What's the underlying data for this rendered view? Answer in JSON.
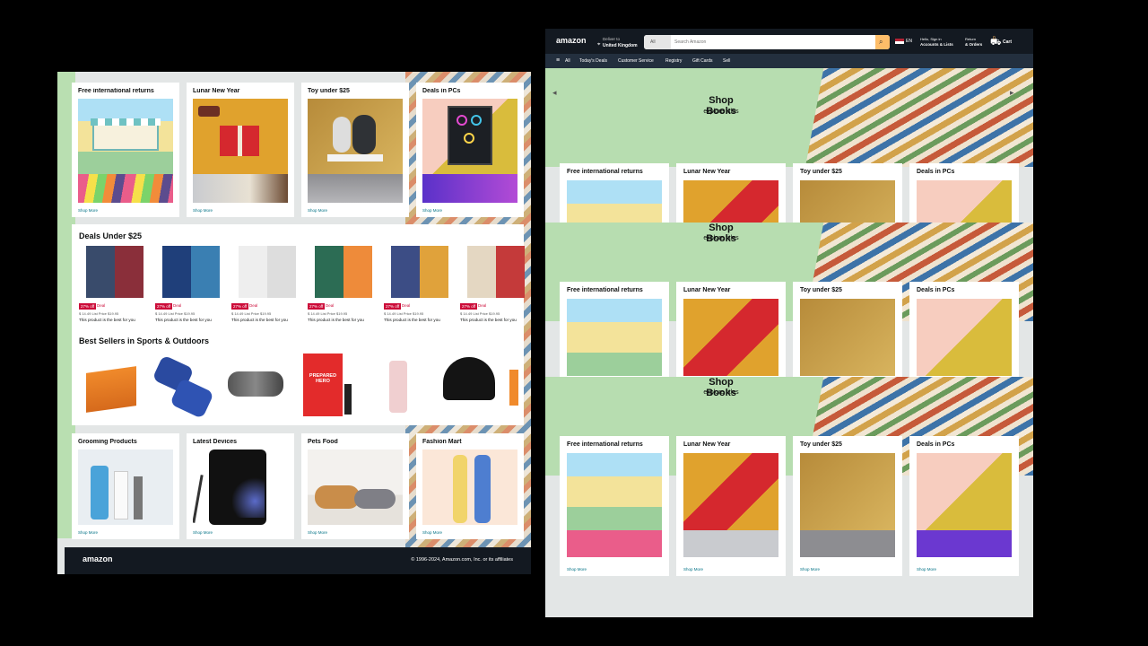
{
  "left": {
    "top_cards": [
      {
        "title": "Free international returns",
        "link": "Shop More"
      },
      {
        "title": "Lunar New Year",
        "link": "Shop More"
      },
      {
        "title": "Toy under $25",
        "link": "Shop More"
      },
      {
        "title": "Deals in PCs",
        "link": "Shop More"
      }
    ],
    "deals": {
      "title": "Deals Under $25",
      "items": [
        {
          "badge": "27% off",
          "label": "Deal",
          "price": "$ 14.49 List Price $19.95",
          "desc": "This product is the best for you"
        },
        {
          "badge": "27% off",
          "label": "Deal",
          "price": "$ 14.49 List Price $19.95",
          "desc": "This product is the best for you"
        },
        {
          "badge": "27% off",
          "label": "Deal",
          "price": "$ 14.49 List Price $19.95",
          "desc": "This product is the best for you"
        },
        {
          "badge": "27% off",
          "label": "Deal",
          "price": "$ 14.49 List Price $19.95",
          "desc": "This product is the best for you"
        },
        {
          "badge": "27% off",
          "label": "Deal",
          "price": "$ 14.49 List Price $19.95",
          "desc": "This product is the best for you"
        },
        {
          "badge": "27% off",
          "label": "Deal",
          "price": "$ 14.49 List Price $19.95",
          "desc": "This product is the best for you"
        }
      ]
    },
    "best_sellers": {
      "title": "Best Sellers in Sports & Outdoors",
      "hero_text": "PREPARED HERO"
    },
    "bottom_cards": [
      {
        "title": "Grooming Products",
        "link": "Shop More"
      },
      {
        "title": "Latest Devices",
        "link": "Shop More"
      },
      {
        "title": "Pets Food",
        "link": "Shop More"
      },
      {
        "title": "Fashion Mart",
        "link": "Shop More"
      }
    ],
    "footer": {
      "logo": "amazon",
      "copyright": "© 1996-2024, Amazon.com, Inc. or its affiliates"
    }
  },
  "right": {
    "header": {
      "logo": "amazon",
      "deliver_to": "Deliver to",
      "location": "United Kingdom",
      "search_category": "All",
      "search_placeholder": "Search Amazon",
      "language": "EN",
      "hello": "Hello, Sign in",
      "accounts": "Accounts & Lists",
      "returns": "Return",
      "orders": "& Orders",
      "cart_count": "0",
      "cart": "Cart"
    },
    "nav": [
      "All",
      "Today's Deals",
      "Customer Service",
      "Registry",
      "Gift Cards",
      "Sell"
    ],
    "banner": {
      "title": "Shop Books",
      "subtitle": "explore titles"
    },
    "cards": [
      {
        "title": "Free international returns",
        "link": "Shop More"
      },
      {
        "title": "Lunar New Year",
        "link": "Shop More"
      },
      {
        "title": "Toy under $25",
        "link": "Shop More"
      },
      {
        "title": "Deals in PCs",
        "link": "Shop More"
      }
    ]
  },
  "colors": {
    "header": "#131921",
    "subnav": "#232f3e",
    "accent": "#febd69",
    "green": "#b7ddb0",
    "deal_red": "#cc0c39",
    "link": "#007185"
  }
}
